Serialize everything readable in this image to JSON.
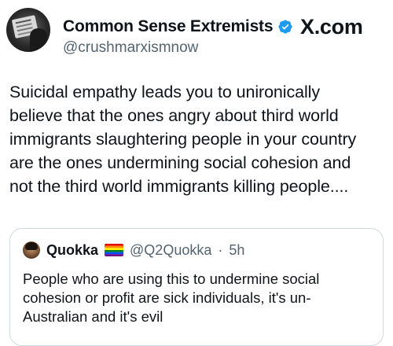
{
  "post": {
    "author_name": "Common Sense Extremists",
    "author_handle": "@crushmarxismnow",
    "verified_icon": "verified-badge-icon",
    "watermark": "X.com",
    "text": "Suicidal empathy leads you to unironically\nbelieve that the ones angry about third world\nimmigrants slaughtering people in your country\nare the ones undermining social cohesion and\nnot the third world immigrants killing people...."
  },
  "quoted_post": {
    "author_name": "Quokka",
    "flag_icon": "rainbow-flag-icon",
    "author_handle": "@Q2Quokka",
    "separator": "·",
    "time": "5h",
    "text": "People who are using this to undermine social\ncohesion or profit are sick individuals, it's un-\nAustralian and it's evil"
  },
  "colors": {
    "text": "#0f1419",
    "secondary_text": "#536471",
    "verified_blue": "#1d9bf0",
    "border": "#cfd9de"
  }
}
